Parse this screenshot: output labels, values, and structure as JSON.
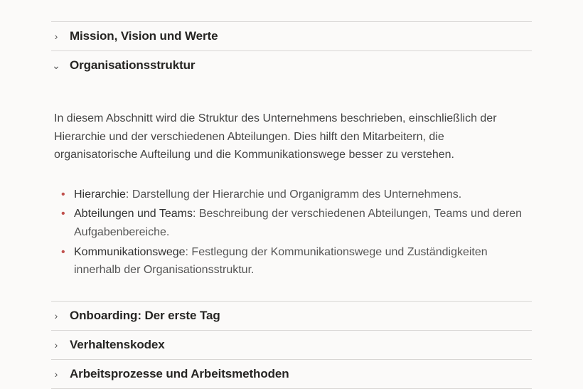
{
  "accordion": {
    "items": [
      {
        "label": "Mission, Vision und Werte",
        "expanded": false
      },
      {
        "label": "Organisationsstruktur",
        "expanded": true
      },
      {
        "label": "Onboarding: Der erste Tag",
        "expanded": false
      },
      {
        "label": "Verhaltenskodex",
        "expanded": false
      },
      {
        "label": "Arbeitsprozesse und Arbeitsmethoden",
        "expanded": false
      }
    ]
  },
  "content": {
    "intro": "In diesem Abschnitt wird die Struktur des Unternehmens beschrieben, einschließlich der Hierarchie und der verschiedenen Abteilungen. Dies hilft den Mitarbeitern, die organisatorische Aufteilung und die Kommunikationswege besser zu verstehen.",
    "bullets": [
      {
        "term": "Hierarchie",
        "desc": ": Darstellung der Hierarchie und Organigramm des Unternehmens."
      },
      {
        "term": "Abteilungen und Teams",
        "desc": ": Beschreibung der verschiedenen Abteilungen, Teams und deren Aufgabenbereiche."
      },
      {
        "term": "Kommunikationswege",
        "desc": ": Festlegung der Kommunikationswege und Zuständigkeiten innerhalb der Organisationsstruktur."
      }
    ]
  }
}
